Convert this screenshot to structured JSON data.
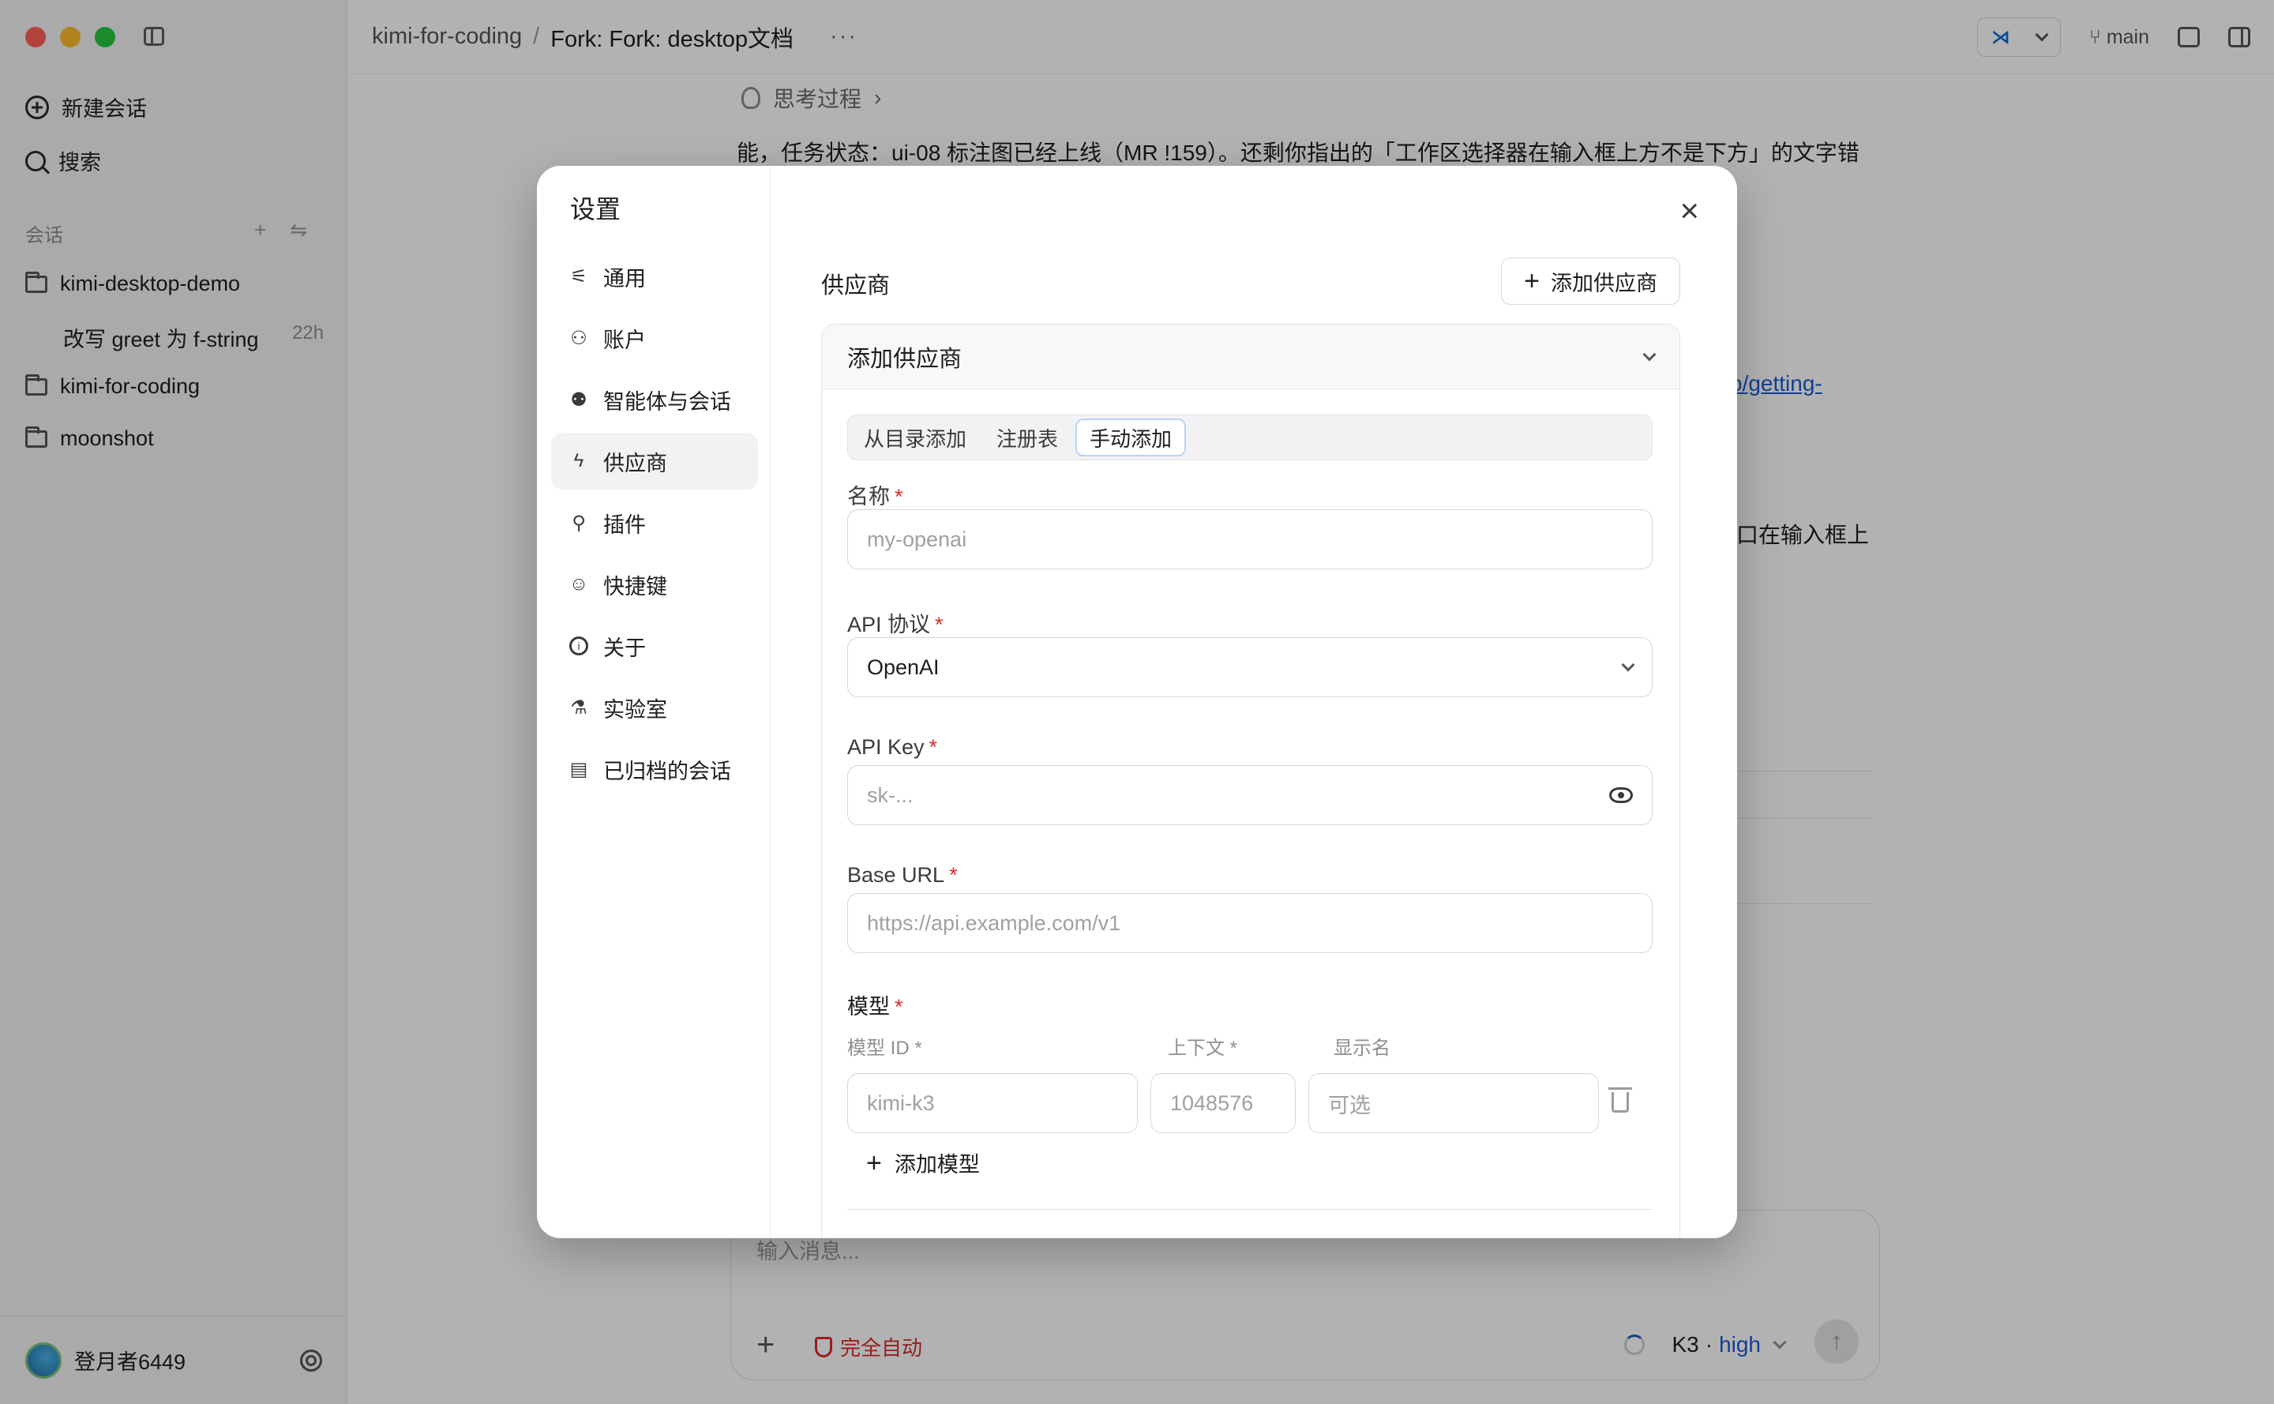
{
  "sidebar": {
    "new_chat": "新建会话",
    "search": "搜索",
    "section_label": "会话",
    "section_add": "+",
    "section_filter": "⇋",
    "folders": [
      {
        "name": "kimi-desktop-demo"
      },
      {
        "name": "kimi-for-coding"
      },
      {
        "name": "moonshot"
      }
    ],
    "sub_session": {
      "title": "改写 greet 为 f-string",
      "time": "22h"
    },
    "user": "登月者6449"
  },
  "topbar": {
    "crumb_project": "kimi-for-coding",
    "crumb_sep": "/",
    "crumb_session": "Fork: Fork: desktop文档",
    "more": "···",
    "branch": "main",
    "editor_logo": "⋊"
  },
  "chat": {
    "thinking": "思考过程",
    "thinking_chevron": "›",
    "message_line": "能，任务状态：ui-08 标注图已经上线（MR !159）。还剩你指出的「工作区选择器在输入框上方不是下方」的文字错",
    "link_fragment": "o/getting-",
    "fragment2": "口在输入框上",
    "composer_placeholder": "输入消息...",
    "composer_plus": "+",
    "auto_mode": "完全自动",
    "model_name": "K3",
    "model_sep": " · ",
    "model_effort": "high",
    "send_arrow": "↑"
  },
  "settings": {
    "title": "设置",
    "close": "×",
    "nav": [
      {
        "label": "通用",
        "icon": "sliders-icon"
      },
      {
        "label": "账户",
        "icon": "user-icon"
      },
      {
        "label": "智能体与会话",
        "icon": "robot-icon"
      },
      {
        "label": "供应商",
        "icon": "bolt-icon",
        "active": true
      },
      {
        "label": "插件",
        "icon": "plugin-icon"
      },
      {
        "label": "快捷键",
        "icon": "keyboard-icon"
      },
      {
        "label": "关于",
        "icon": "info-icon"
      },
      {
        "label": "实验室",
        "icon": "flask-icon"
      },
      {
        "label": "已归档的会话",
        "icon": "archive-icon"
      }
    ],
    "nav_glyphs": {
      "sliders": "⚟",
      "user": "⚇",
      "robot": "⚉",
      "bolt": "ϟ",
      "plugin": "⚲",
      "keyboard": "☺",
      "info": "i",
      "flask": "⚗",
      "archive": "▤"
    },
    "section_title": "供应商",
    "add_provider_button": "添加供应商",
    "add_provider_plus": "+",
    "card_title": "添加供应商",
    "tabs": [
      "从目录添加",
      "注册表",
      "手动添加"
    ],
    "active_tab": "手动添加",
    "fields": {
      "name_label": "名称",
      "name_placeholder": "my-openai",
      "protocol_label": "API 协议",
      "protocol_value": "OpenAI",
      "key_label": "API Key",
      "key_placeholder": "sk-...",
      "base_url_label": "Base URL",
      "base_url_placeholder": "https://api.example.com/v1",
      "models_label": "模型",
      "model_id_label": "模型 ID *",
      "context_label": "上下文 *",
      "display_label": "显示名",
      "model_id_placeholder": "kimi-k3",
      "context_placeholder": "1048576",
      "display_placeholder": "可选",
      "add_model": "添加模型",
      "add_model_plus": "+",
      "required_mark": "*"
    }
  },
  "colors": {
    "accent": "#1a5bd6",
    "danger": "#d92b2b",
    "overlay": "rgba(0,0,0,0.30)"
  }
}
